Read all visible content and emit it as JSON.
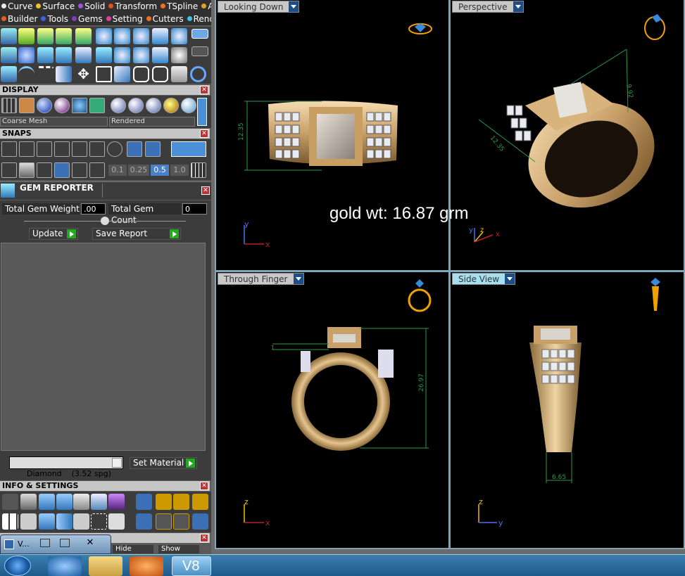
{
  "menus": {
    "row1": [
      {
        "label": "Curve",
        "color": "#e8e8e8"
      },
      {
        "label": "Surface",
        "color": "#f0c020"
      },
      {
        "label": "Solid",
        "color": "#a050e0"
      },
      {
        "label": "Transform",
        "color": "#e05020"
      },
      {
        "label": "TSpline",
        "color": "#f07020"
      },
      {
        "label": "Art",
        "color": "#e0a030"
      }
    ],
    "row2": [
      {
        "label": "Builder",
        "color": "#e06020"
      },
      {
        "label": "Tools",
        "color": "#4060e0"
      },
      {
        "label": "Gems",
        "color": "#8040c0"
      },
      {
        "label": "Setting",
        "color": "#e040a0"
      },
      {
        "label": "Cutters",
        "color": "#f07020"
      },
      {
        "label": "Render",
        "color": "#40c0e0"
      }
    ]
  },
  "display": {
    "header": "DISPLAY",
    "mesh_select": "Coarse Mesh",
    "render_select": "Rendered"
  },
  "snaps": {
    "header": "SNAPS",
    "values": [
      "0.1",
      "0.25",
      "0.5",
      "1.0"
    ]
  },
  "gem_reporter": {
    "header": "GEM REPORTER",
    "weight_label": "Total Gem Weight",
    "weight_value": ".00",
    "count_label": "Total Gem Count",
    "count_value": "0",
    "update_label": "Update",
    "save_label": "Save Report",
    "material_select": "Diamond    (3.52 spg)",
    "set_material_label": "Set Material"
  },
  "info": {
    "header": "INFO & SETTINGS"
  },
  "bottom_panel": {
    "window_title": "V...",
    "hide_label": "Hide",
    "show_label": "Show"
  },
  "viewports": {
    "top_left": {
      "tab": "Looking Down",
      "dimension": "12.35",
      "axis1": "y",
      "axis2": "x"
    },
    "top_right": {
      "tab": "Perspective",
      "dim_a": "12.35",
      "dim_b": "9.92",
      "axis1": "y",
      "axis2": "z",
      "axis3": "x"
    },
    "bottom_left": {
      "tab": "Through Finger",
      "dimension": "26.97",
      "small_dim": "1",
      "axis1": "z",
      "axis2": "x"
    },
    "bottom_right": {
      "tab": "Side View",
      "dimension": "6.65",
      "axis1": "z",
      "axis2": "y"
    }
  },
  "overlay": {
    "gold_weight": "gold wt: 16.87 grm"
  },
  "taskbar": {
    "v8_label": "V8"
  }
}
